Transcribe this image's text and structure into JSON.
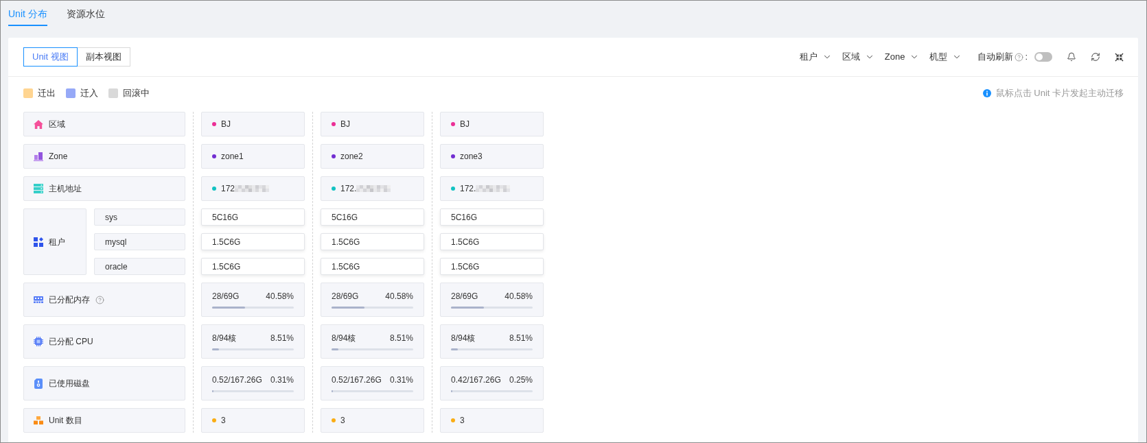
{
  "tabs": [
    {
      "label": "Unit 分布",
      "selected": true
    },
    {
      "label": "资源水位",
      "selected": false
    }
  ],
  "views": [
    {
      "label": "Unit 视图",
      "selected": true
    },
    {
      "label": "副本视图",
      "selected": false
    }
  ],
  "filters": [
    {
      "label": "租户"
    },
    {
      "label": "区域"
    },
    {
      "label": "Zone"
    },
    {
      "label": "机型"
    }
  ],
  "auto_refresh": {
    "label": "自动刷新",
    "suffix": ":",
    "on": false
  },
  "legend": [
    {
      "label": "迁出",
      "color": "#ffd591"
    },
    {
      "label": "迁入",
      "color": "#96a9f7"
    },
    {
      "label": "回滚中",
      "color": "#d9d9d9"
    }
  ],
  "hint": "鼠标点击 Unit 卡片发起主动迁移",
  "rows": [
    {
      "kind": "region",
      "label": "区域",
      "help": false
    },
    {
      "kind": "zone",
      "label": "Zone",
      "help": false
    },
    {
      "kind": "host",
      "label": "主机地址",
      "help": false
    },
    {
      "kind": "tenant",
      "label": "租户",
      "help": false,
      "tenants": [
        "sys",
        "mysql",
        "oracle"
      ]
    },
    {
      "kind": "memory",
      "label": "已分配内存",
      "help": true
    },
    {
      "kind": "cpu",
      "label": "已分配 CPU",
      "help": false
    },
    {
      "kind": "disk",
      "label": "已使用磁盘",
      "help": false
    },
    {
      "kind": "units",
      "label": "Unit 数目",
      "help": false
    }
  ],
  "columns": [
    {
      "cells": [
        {
          "text": "BJ",
          "color": "#eb2f96"
        },
        {
          "text": "zone1",
          "color": "#722ed1"
        },
        {
          "text": "172",
          "color": "#13c2c2",
          "masked": true
        },
        {
          "specs": [
            "5C16G",
            "1.5C6G",
            "1.5C6G"
          ]
        },
        {
          "used": "28/69G",
          "percent": "40.58%",
          "level": 0.4058
        },
        {
          "used": "8/94核",
          "percent": "8.51%",
          "level": 0.0851
        },
        {
          "used": "0.52/167.26G",
          "percent": "0.31%",
          "level": 0.0031
        },
        {
          "text": "3",
          "color": "#faad14"
        }
      ]
    },
    {
      "cells": [
        {
          "text": "BJ",
          "color": "#eb2f96"
        },
        {
          "text": "zone2",
          "color": "#722ed1"
        },
        {
          "text": "172.",
          "color": "#13c2c2",
          "masked": true
        },
        {
          "specs": [
            "5C16G",
            "1.5C6G",
            "1.5C6G"
          ]
        },
        {
          "used": "28/69G",
          "percent": "40.58%",
          "level": 0.4058
        },
        {
          "used": "8/94核",
          "percent": "8.51%",
          "level": 0.0851
        },
        {
          "used": "0.52/167.26G",
          "percent": "0.31%",
          "level": 0.0031
        },
        {
          "text": "3",
          "color": "#faad14"
        }
      ]
    },
    {
      "cells": [
        {
          "text": "BJ",
          "color": "#eb2f96"
        },
        {
          "text": "zone3",
          "color": "#722ed1"
        },
        {
          "text": "172.",
          "color": "#13c2c2",
          "masked": true
        },
        {
          "specs": [
            "5C16G",
            "1.5C6G",
            "1.5C6G"
          ]
        },
        {
          "used": "28/69G",
          "percent": "40.58%",
          "level": 0.4058
        },
        {
          "used": "8/94核",
          "percent": "8.51%",
          "level": 0.0851
        },
        {
          "used": "0.42/167.26G",
          "percent": "0.25%",
          "level": 0.0025
        },
        {
          "text": "3",
          "color": "#faad14"
        }
      ]
    }
  ]
}
